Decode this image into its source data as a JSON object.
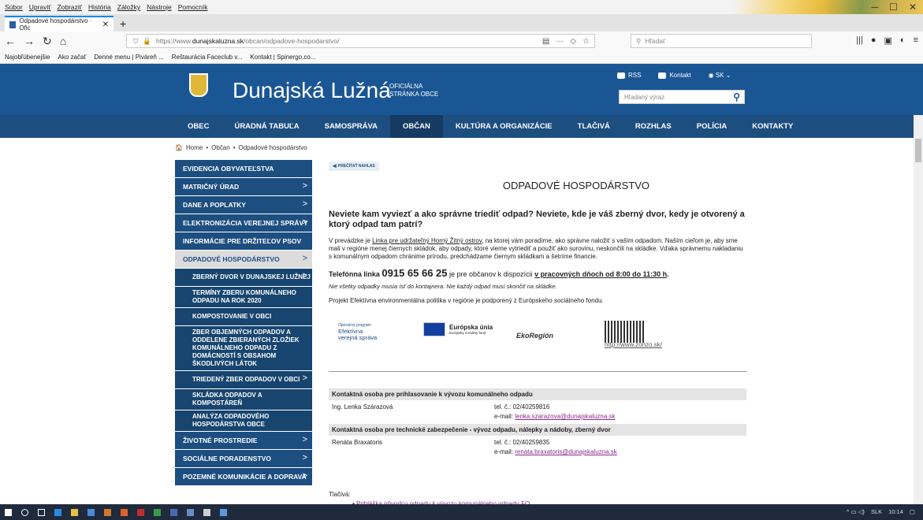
{
  "menubar": {
    "items": [
      "Súbor",
      "Upraviť",
      "Zobraziť",
      "História",
      "Záložky",
      "Nástroje",
      "Pomocník"
    ]
  },
  "browser": {
    "tab_title": "Odpadové hospodárstvo · Ofic",
    "url_prefix": "https://www.",
    "url_domain": "dunajskaluzna.sk",
    "url_path": "/obcan/odpadove-hospodarstvo/",
    "search_placeholder": "Hľadať",
    "bookmarks": [
      "Najobľúbenejšie",
      "Ako začať",
      "Denné menu | Piváreň ...",
      "Reštaurácia Faceclub v...",
      "Kontakt | Spinergo.co..."
    ]
  },
  "site": {
    "name": "Dunajská Lužná",
    "official_line1": "OFICIÁLNA",
    "official_line2": "STRÁNKA OBCE",
    "rss": "RSS",
    "kontakt": "Kontakt",
    "lang": "SK",
    "search_placeholder": "Hľadaný výraz"
  },
  "nav": [
    "OBEC",
    "ÚRADNÁ TABUĽA",
    "SAMOSPRÁVA",
    "OBČAN",
    "KULTÚRA A ORGANIZÁCIE",
    "TLAČIVÁ",
    "ROZHLAS",
    "POLÍCIA",
    "KONTAKTY"
  ],
  "breadcrumb": {
    "home": "Home",
    "sep": "•",
    "level1": "Občan",
    "level2": "Odpadové hospodárstvo"
  },
  "sidebar": [
    {
      "label": "EVIDENCIA OBYVATEĽSTVA",
      "chev": ""
    },
    {
      "label": "MATRIČNÝ ÚRAD",
      "chev": ">"
    },
    {
      "label": "DANE A POPLATKY",
      "chev": ">"
    },
    {
      "label": "ELEKTRONIZÁCIA VEREJNEJ SPRÁVY",
      "chev": ">"
    },
    {
      "label": "INFORMÁCIE PRE DRŽITEĽOV PSOV",
      "chev": ""
    },
    {
      "label": "ODPADOVÉ HOSPODÁRSTVO",
      "chev": ">"
    },
    {
      "label": "ZBERNÝ DVOR V DUNAJSKEJ LUŽNEJ",
      "chev": ">"
    },
    {
      "label": "TERMÍNY ZBERU KOMUNÁLNEHO ODPADU NA ROK 2020",
      "chev": ""
    },
    {
      "label": "KOMPOSTOVANIE V OBCI",
      "chev": ""
    },
    {
      "label": "ZBER OBJEMNÝCH ODPADOV A ODDELENE ZBIERANÝCH ZLOŽIEK KOMUNÁLNEHO ODPADU Z DOMÁCNOSTÍ S OBSAHOM ŠKODLIVÝCH LÁTOK",
      "chev": ""
    },
    {
      "label": "TRIEDENÝ ZBER ODPADOV V OBCI",
      "chev": ">"
    },
    {
      "label": "SKLÁDKA ODPADOV A KOMPOSTÁREŇ",
      "chev": ""
    },
    {
      "label": "ANALÝZA ODPADOVÉHO HOSPODÁRSTVA OBCE",
      "chev": ""
    },
    {
      "label": "ŽIVOTNÉ PROSTREDIE",
      "chev": ">"
    },
    {
      "label": "SOCIÁLNE PORADENSTVO",
      "chev": ">"
    },
    {
      "label": "POZEMNÉ KOMUNIKÁCIE A DOPRAVA",
      "chev": ">"
    }
  ],
  "content": {
    "read_button": "PREČÍTAŤ NAHLAS",
    "title": "ODPADOVÉ HOSPODÁRSTVO",
    "heading": "Neviete kam vyviezť a ako správne triediť odpad? Neviete, kde je váš zberný dvor, kedy je otvorený a ktorý odpad tam patrí?",
    "para_before": "V prevádzke je ",
    "para_link": "Linka pre udržateľný Horný Žitný ostrov",
    "para_after": ", na ktorej vám poradíme, ako správne naložiť s vaším odpadom. Naším cieľom je, aby sme mali v regióne menej čiernych skládok, aby odpady, ktoré vieme vytriediť a použiť ako surovinu, neskončili na skládke. Vďaka správnemu nakladaniu s komunálnym odpadom chránime prírodu, predchádzame čiernym skládkam a šetríme financie.",
    "phone_label": "Telefónna linka",
    "phone_number": "0915 65 66 25",
    "phone_mid": "je pre občanov k dispozícii",
    "phone_hours": "v pracovných dňoch od 8:00 do 11:30 h",
    "phone_end": ".",
    "italic": "Nie všetky odpadky musia ísť do kontajnera. Nie každý odpad musí skončiť na skládke.",
    "project": "Projekt Efektívna environmentálna politika v regióne je podporený z Európskeho sociálneho fondu.",
    "logo1_small": "Operačný program",
    "logo1_l1": "Efektívna",
    "logo1_l2": "verejná správa",
    "logo2_name": "Európska únia",
    "logo2_sub": "Európsky sociálny fond",
    "logo3": "EkoRegión",
    "zohzo_link": "http://www.zohzo.sk/",
    "contacts": [
      {
        "header": "Kontaktná osoba pre prihlasovanie k vývozu komunálneho odpadu",
        "name": "Ing. Lenka Szárazová",
        "tel": "tel. č.: 02/40259816",
        "email_label": "e-mail:",
        "email": "lenka.szarazova@dunajskaluzna.sk"
      },
      {
        "header": "Kontaktná osoba pre technické zabezpečenie - vývoz odpadu, nálepky a nádoby, zberný dvor",
        "name": "Renáta Braxatoris",
        "tel": "tel. č.: 02/40259835",
        "email_label": "e-mail:",
        "email": "renata.braxatoris@dunajskaluzna.sk"
      }
    ],
    "tlaciva_label": "Tlačivá:",
    "tlaciva_item": "Prihláška pôvodcu odpadu k vývozu komunálneho odpadu FO"
  },
  "taskbar": {
    "lang": "SLK",
    "time": "10:14"
  }
}
